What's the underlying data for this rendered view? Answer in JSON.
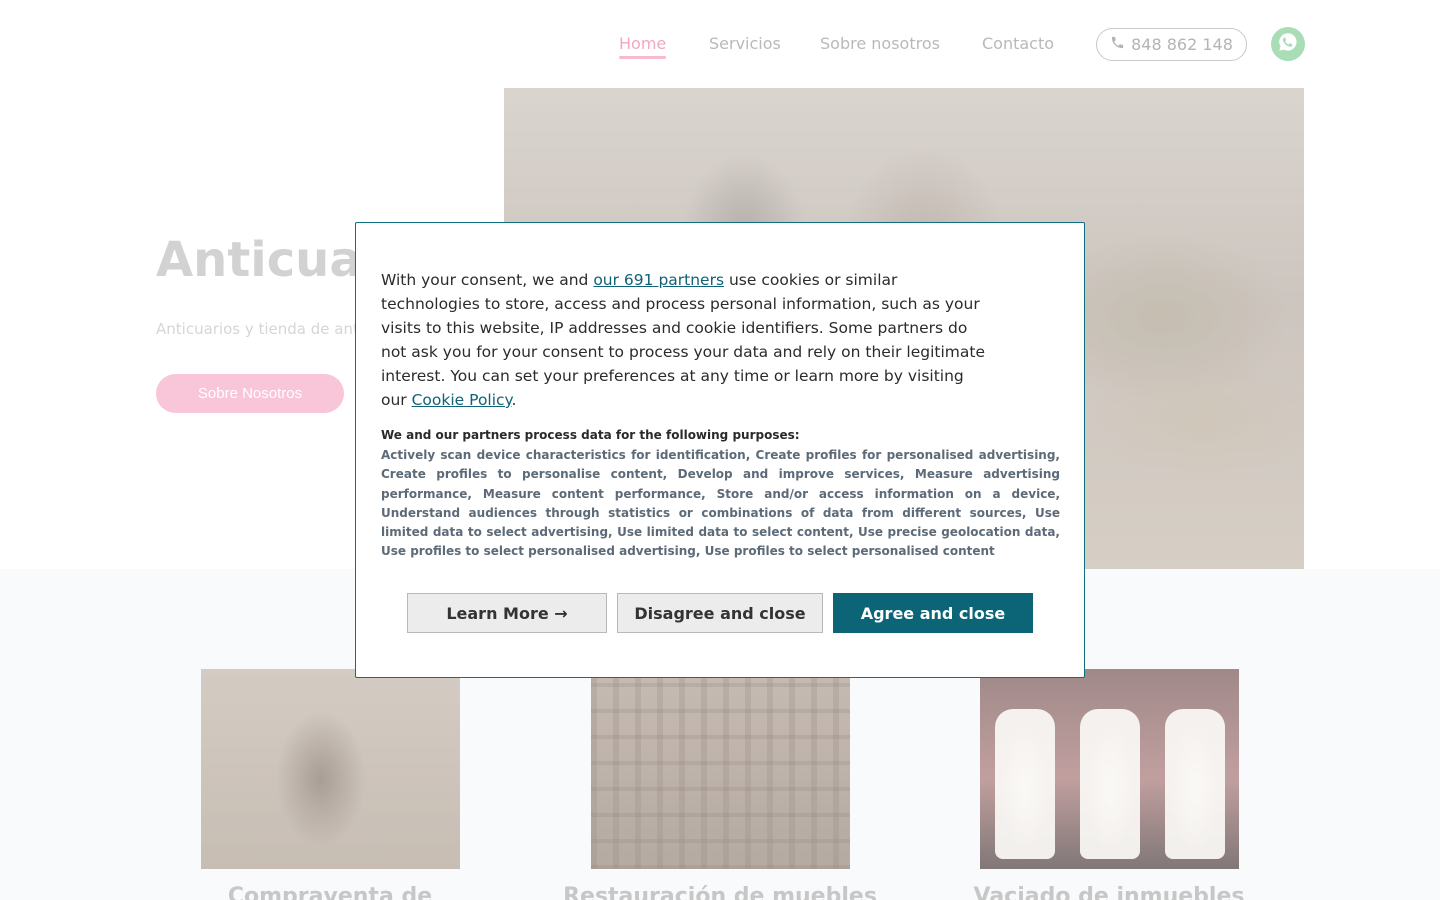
{
  "nav": {
    "links": [
      "Home",
      "Servicios",
      "Sobre nosotros",
      "Contacto"
    ],
    "phone": "848 862 148",
    "accent_color": "#f8b8cf"
  },
  "hero": {
    "title": "Anticuar",
    "subtitle": "Anticuarios y tienda de ant",
    "button": "Sobre Nosotros"
  },
  "services": {
    "titles": [
      "Compraventa de",
      "Restauración de muebles",
      "Vaciado de inmuebles"
    ]
  },
  "cookie": {
    "text_before_link": "With your consent, we and ",
    "partners_link": "our 691 partners",
    "text_main": " use cookies or similar technologies to store, access and process personal information, such as your visits to this website, IP addresses and cookie identifiers. Some partners do not ask you for your consent to process your data and rely on their legitimate interest. You can set your preferences at any time or learn more by visiting our ",
    "policy_link": "Cookie Policy",
    "text_end": ".",
    "purposes_heading": "We and our partners process data for the following purposes:",
    "purposes": "Actively scan device characteristics for identification, Create profiles for personalised advertising, Create profiles to personalise content, Develop and improve services, Measure advertising performance, Measure content performance, Store and/or access information on a device, Understand audiences through statistics or combinations of data from different sources, Use limited data to select advertising, Use limited data to select content, Use precise geolocation data, Use profiles to select personalised advertising, Use profiles to select personalised content",
    "buttons": {
      "learn": "Learn More →",
      "disagree": "Disagree and close",
      "agree": "Agree and close"
    },
    "primary_color": "#0b6577"
  }
}
